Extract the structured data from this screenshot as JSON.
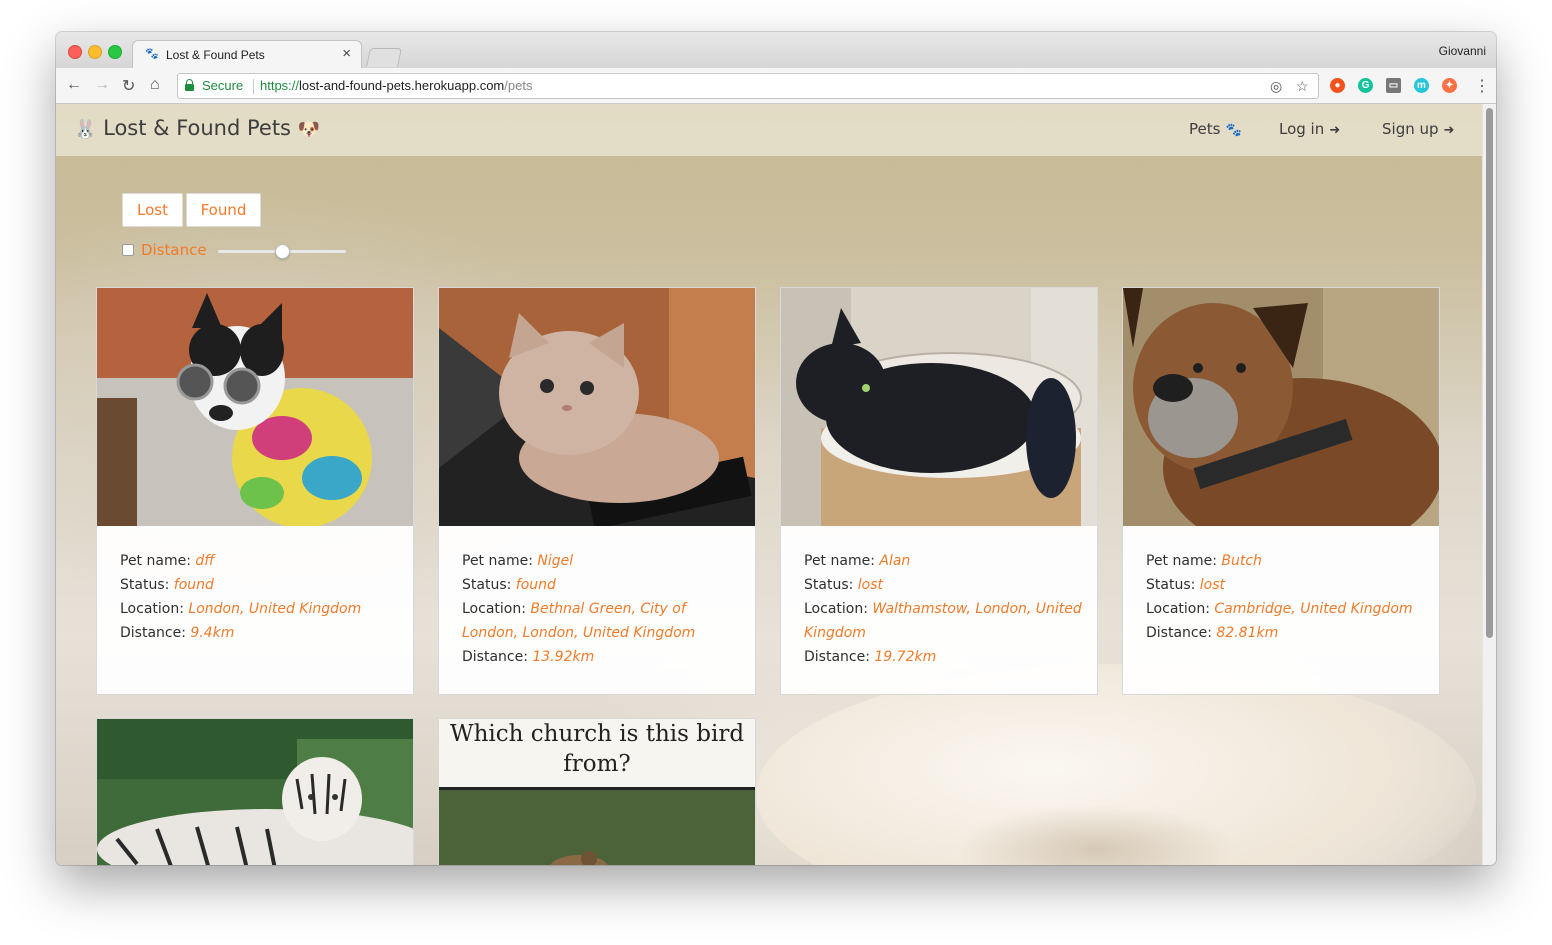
{
  "browser": {
    "tab_title": "Lost & Found Pets",
    "tab_close": "×",
    "profile_name": "Giovanni",
    "secure_label": "Secure",
    "url_scheme": "https://",
    "url_host": "lost-and-found-pets.herokuapp.com",
    "url_path": "/pets",
    "icons": {
      "back": "←",
      "forward": "→",
      "reload": "↻",
      "home": "⌂",
      "location": "◎",
      "bookmark": "☆",
      "menu": "⋮"
    },
    "extensions": [
      {
        "name": "fire-extension-icon",
        "glyph": "●",
        "color": "#f4511e"
      },
      {
        "name": "grammarly-extension-icon",
        "glyph": "G",
        "color": "#15c39a"
      },
      {
        "name": "cast-icon",
        "glyph": "▭",
        "color": "#777777"
      },
      {
        "name": "m-extension-icon",
        "glyph": "m",
        "color": "#26c6da"
      },
      {
        "name": "puzzle-extension-icon",
        "glyph": "✦",
        "color": "#ff7043"
      }
    ]
  },
  "app": {
    "brand_left_emoji": "🐰",
    "brand_name": "Lost & Found Pets",
    "brand_right_emoji": "🐶",
    "nav": {
      "pets": "Pets",
      "pets_icon": "🐾",
      "login": "Log in",
      "login_icon": "➜",
      "signup": "Sign up",
      "signup_icon": "➜"
    },
    "accent_color": "#f07b2a"
  },
  "filters": {
    "lost_label": "Lost",
    "found_label": "Found",
    "distance_label": "Distance",
    "distance_checked": false,
    "slider_fraction": 0.5
  },
  "labels": {
    "pet_name": "Pet name:",
    "status": "Status:",
    "location": "Location:",
    "distance": "Distance:"
  },
  "pets": [
    {
      "name": "dff",
      "status": "found",
      "location": "London, United Kingdom",
      "distance": "9.4km",
      "photo": "boston-terrier-sunglasses"
    },
    {
      "name": "Nigel",
      "status": "found",
      "location": "Bethnal Green, City of London, London, United Kingdom",
      "distance": "13.92km",
      "photo": "kitten-on-laptop"
    },
    {
      "name": "Alan",
      "status": "lost",
      "location": "Walthamstow, London, United Kingdom",
      "distance": "19.72km",
      "photo": "black-cat-in-basket"
    },
    {
      "name": "Butch",
      "status": "lost",
      "location": "Cambridge, United Kingdom",
      "distance": "82.81km",
      "photo": "boxer-dog"
    },
    {
      "photo": "white-tiger"
    },
    {
      "photo": "bird-meme",
      "caption": "Which church is this bird from?"
    }
  ]
}
